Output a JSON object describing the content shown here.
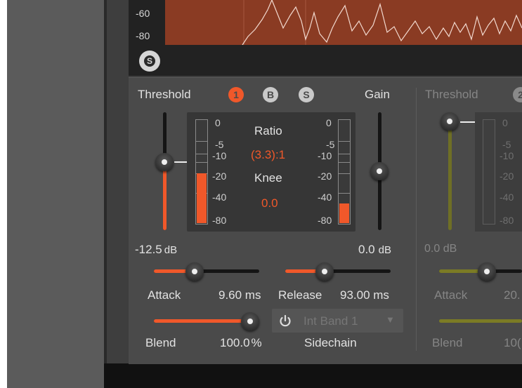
{
  "header": {
    "db_labels": [
      "-60",
      "-80"
    ],
    "solo_icon_label": "S"
  },
  "band1": {
    "threshold_label": "Threshold",
    "badges": [
      "1",
      "B",
      "S"
    ],
    "gain_label": "Gain",
    "left_meter_ticks": [
      "0",
      "-5",
      "-10",
      "-20",
      "-40",
      "-80"
    ],
    "right_meter_ticks": [
      "0",
      "-5",
      "-10",
      "-20",
      "-40",
      "-80"
    ],
    "ratio_label": "Ratio",
    "ratio_value": "(3.3):1",
    "knee_label": "Knee",
    "knee_value": "0.0",
    "threshold_value": "-12.5",
    "threshold_unit": "dB",
    "gain_value": "0.0",
    "gain_unit": "dB",
    "attack_label": "Attack",
    "attack_value": "9.60 ms",
    "release_label": "Release",
    "release_value": "93.00 ms",
    "blend_label": "Blend",
    "blend_value": "100.0",
    "blend_unit": "%",
    "sidechain_value": "Int Band 1",
    "sidechain_label": "Sidechain",
    "threshold_level": 0.55,
    "gain_level": 0.5,
    "attack_level": 0.4,
    "release_level": 0.38,
    "blend_level": 1.0,
    "left_meter_level": 0.48,
    "right_meter_level": 0.2
  },
  "band2": {
    "threshold_label": "Threshold",
    "badge": "2",
    "meter_ticks": [
      "0",
      "-5",
      "-10",
      "-20",
      "-40",
      "-80"
    ],
    "threshold_value": "0.0 dB",
    "attack_label": "Attack",
    "attack_value": "20.",
    "blend_label": "Blend",
    "blend_value": "10("
  },
  "colors": {
    "accent": "#f0582a",
    "band2_accent": "#7b7b25",
    "spectrum": "#8a3b23"
  }
}
